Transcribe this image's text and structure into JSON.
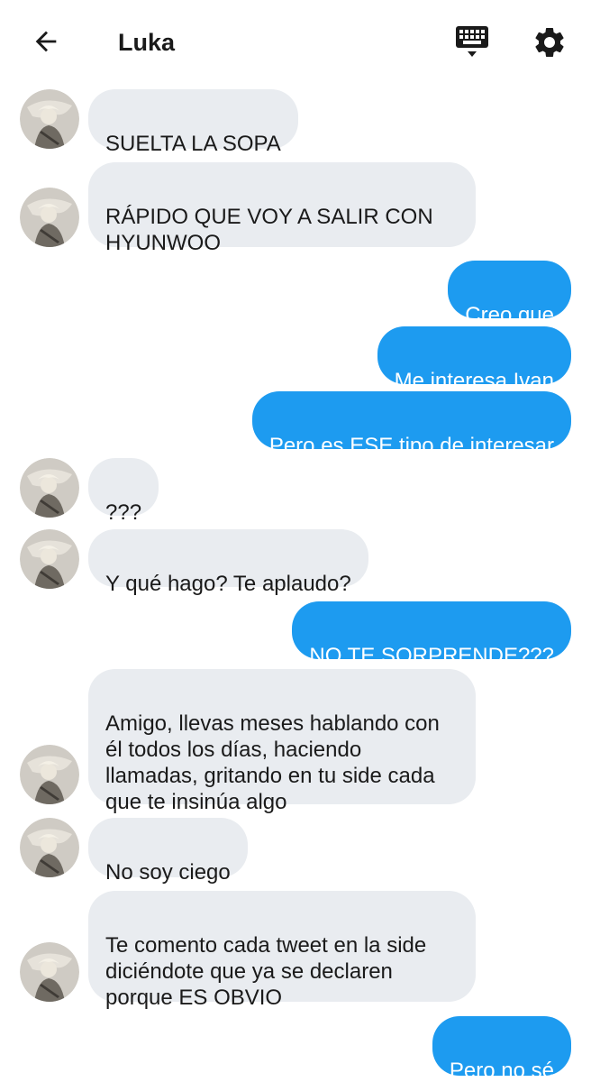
{
  "header": {
    "title": "Luka",
    "back_icon": "arrow-left-icon",
    "keyboard_icon": "keyboard-icon",
    "settings_icon": "gear-icon"
  },
  "colors": {
    "incoming_bubble": "#e9ecf0",
    "outgoing_bubble": "#1d9bf0",
    "outgoing_text": "#ffffff",
    "text": "#1a1a1a"
  },
  "messages": [
    {
      "side": "in",
      "text": "SUELTA LA SOPA"
    },
    {
      "side": "in",
      "text": "RÁPIDO QUE VOY A SALIR CON HYUNWOO"
    },
    {
      "side": "out",
      "text": "Creo que"
    },
    {
      "side": "out",
      "text": "Me interesa Ivan"
    },
    {
      "side": "out",
      "text": "Pero es ESE tipo de interesar"
    },
    {
      "side": "in",
      "text": "???"
    },
    {
      "side": "in",
      "text": "Y qué hago? Te aplaudo?"
    },
    {
      "side": "out",
      "text": "NO TE SORPRENDE???"
    },
    {
      "side": "in",
      "text": "Amigo, llevas meses hablando con él todos los días, haciendo llamadas, gritando en tu side cada que te insinúa algo"
    },
    {
      "side": "in",
      "text": "No soy ciego"
    },
    {
      "side": "in",
      "text": "Te comento cada tweet en la side diciéndote que ya se declaren porque ES OBVIO"
    },
    {
      "side": "out",
      "text": "Pero no sé"
    }
  ]
}
